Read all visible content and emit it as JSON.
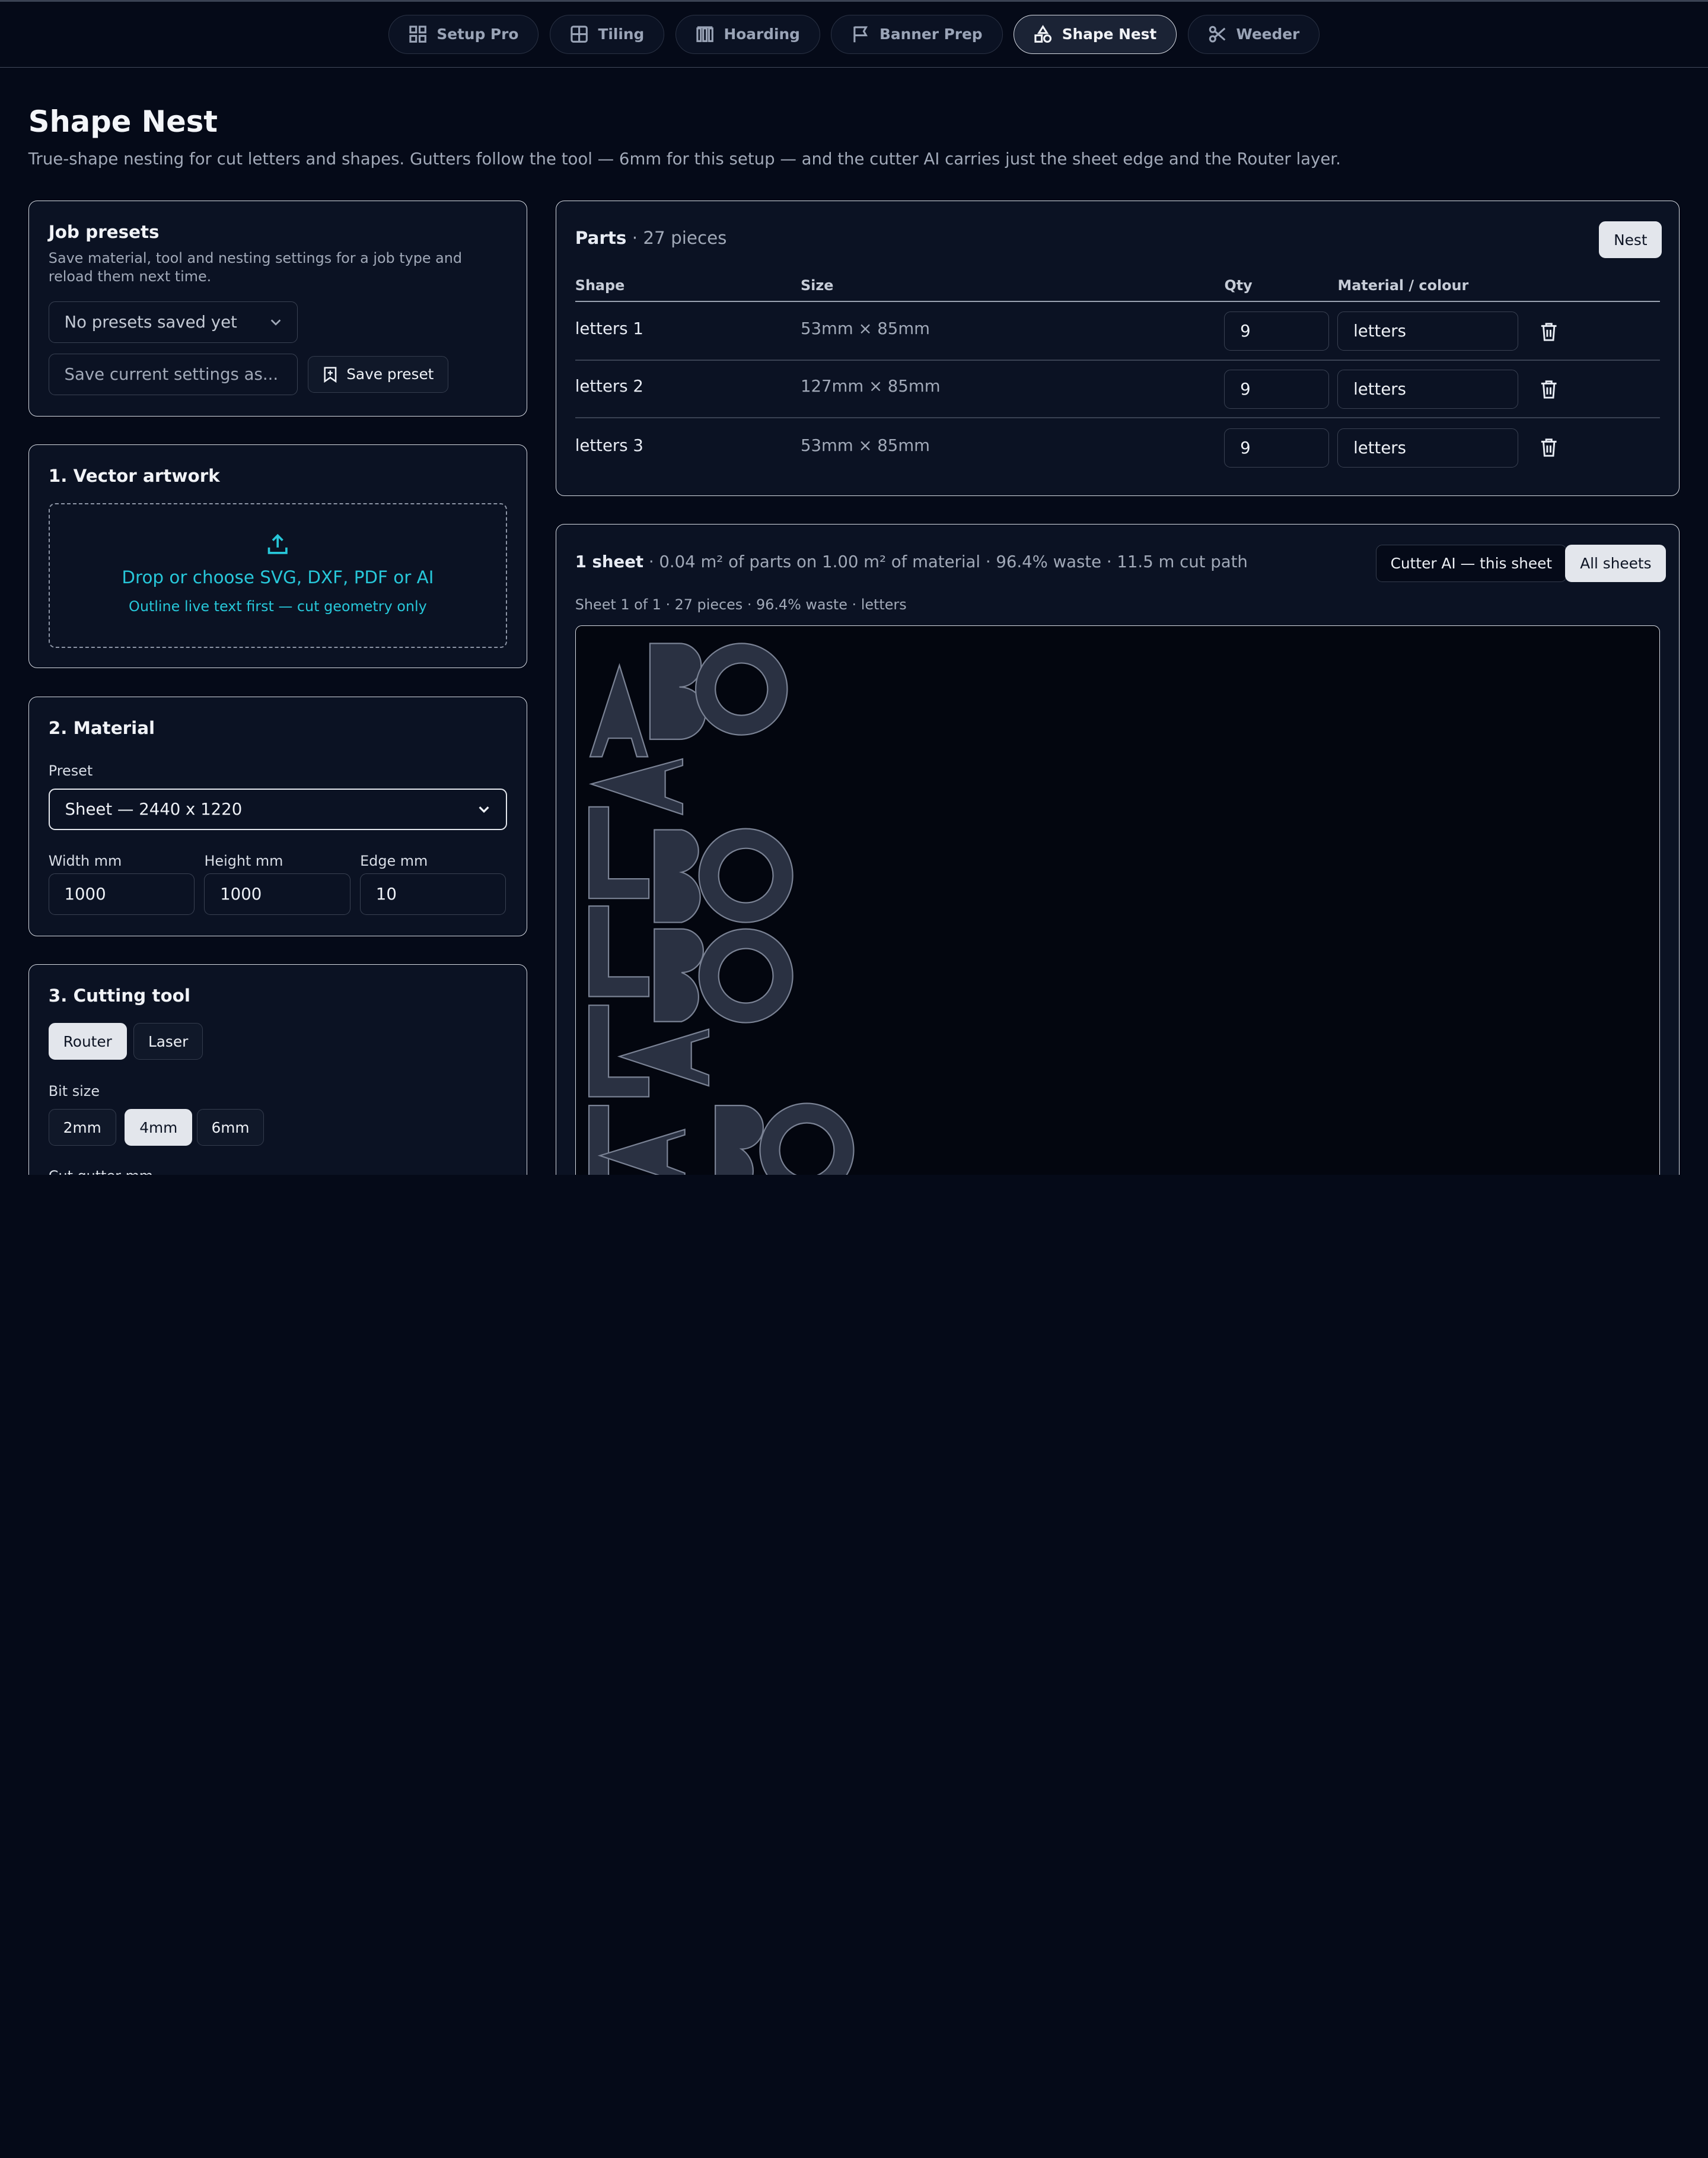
{
  "tabs": [
    {
      "label": "Setup Pro",
      "icon": "grid-icon"
    },
    {
      "label": "Tiling",
      "icon": "tiles-icon"
    },
    {
      "label": "Hoarding",
      "icon": "hoarding-icon"
    },
    {
      "label": "Banner Prep",
      "icon": "flag-icon"
    },
    {
      "label": "Shape Nest",
      "icon": "shapes-icon",
      "active": true
    },
    {
      "label": "Weeder",
      "icon": "scissors-icon"
    }
  ],
  "page": {
    "title": "Shape Nest",
    "subtitle": "True-shape nesting for cut letters and shapes. Gutters follow the tool — 6mm for this setup — and the cutter AI carries just the sheet edge and the Router layer."
  },
  "presets": {
    "title": "Job presets",
    "description": "Save material, tool and nesting settings for a job type and reload them next time.",
    "select_value": "No presets saved yet",
    "name_placeholder": "Save current settings as...",
    "save_label": "Save preset"
  },
  "artwork": {
    "title": "1. Vector artwork",
    "drop_label": "Drop or choose SVG, DXF, PDF or AI",
    "hint": "Outline live text first — cut geometry only"
  },
  "material": {
    "title": "2. Material",
    "preset_label": "Preset",
    "preset_value": "Sheet — 2440 x 1220",
    "width_label": "Width mm",
    "width_value": "1000",
    "height_label": "Height mm",
    "height_value": "1000",
    "edge_label": "Edge mm",
    "edge_value": "10"
  },
  "tool": {
    "title": "3. Cutting tool",
    "types": [
      "Router",
      "Laser"
    ],
    "active_type": "Router",
    "bit_label": "Bit size",
    "bits": [
      "2mm",
      "4mm",
      "6mm"
    ],
    "active_bit": "4mm",
    "gutter_label": "Cut gutter mm"
  },
  "parts": {
    "title": "Parts",
    "count": "· 27 pieces",
    "nest_label": "Nest",
    "headers": {
      "shape": "Shape",
      "size": "Size",
      "qty": "Qty",
      "material": "Material / colour"
    },
    "rows": [
      {
        "shape": "letters 1",
        "size": "53mm × 85mm",
        "qty": "9",
        "material": "letters"
      },
      {
        "shape": "letters 2",
        "size": "127mm × 85mm",
        "qty": "9",
        "material": "letters"
      },
      {
        "shape": "letters 3",
        "size": "53mm × 85mm",
        "qty": "9",
        "material": "letters"
      }
    ]
  },
  "result": {
    "sheets": "1 sheet",
    "summary": "· 0.04 m² of parts on 1.00 m² of material · 96.4% waste · 11.5 m cut path",
    "cutter_label": "Cutter AI — this sheet",
    "all_label": "All sheets",
    "sheet_caption": "Sheet 1 of 1 · 27 pieces · 96.4% waste · letters"
  },
  "colors": {
    "background": "#050a18",
    "panel": "#0b1223",
    "accent": "#27c7d9",
    "shape_fill": "#2a3142"
  }
}
